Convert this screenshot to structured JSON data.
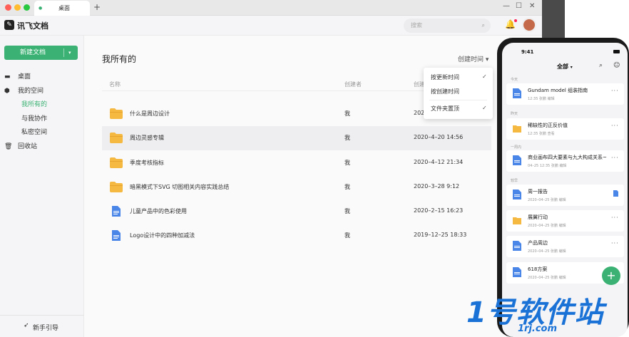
{
  "browser": {
    "tab_label": "桌面",
    "new_tab": "+",
    "min": "—",
    "max": "☐",
    "close": "✕"
  },
  "app": {
    "title": "讯飞文档",
    "logo_glyph": "✎",
    "search_placeholder": "搜索",
    "search_icon": "⌕",
    "bell_icon": "🔔"
  },
  "sidebar": {
    "new_button": "新建文档",
    "new_caret": "▾",
    "items": [
      {
        "label": "桌面",
        "icon": "▬"
      },
      {
        "label": "我的空间",
        "icon": "⬢"
      },
      {
        "label": "我所有的"
      },
      {
        "label": "与我协作"
      },
      {
        "label": "私密空间"
      },
      {
        "label": "回收站",
        "icon": "🗑"
      }
    ],
    "guide": "新手引导",
    "guide_icon": "➶"
  },
  "main": {
    "title": "我所有的",
    "sort_label": "创建时间 ▾",
    "headers": {
      "name": "名称",
      "creator": "创建者",
      "date": "创建"
    },
    "rows": [
      {
        "name": "什么是周边设计",
        "creator": "我",
        "date": "2020",
        "type": "folder"
      },
      {
        "name": "周边灵感专辑",
        "creator": "我",
        "date": "2020–4–20 14:56",
        "type": "folder"
      },
      {
        "name": "季度考核指标",
        "creator": "我",
        "date": "2020–4–12 21:34",
        "type": "folder"
      },
      {
        "name": "暗黑模式下SVG 切图相关内容实践总结",
        "creator": "我",
        "date": "2020–3–28 9:12",
        "type": "folder"
      },
      {
        "name": "儿童产品中的色彩使用",
        "creator": "我",
        "date": "2020–2–15 16:23",
        "type": "doc"
      },
      {
        "name": "Logo设计中的四种加减法",
        "creator": "我",
        "date": "2019–12–25  18:33",
        "type": "doc"
      }
    ],
    "menu": {
      "items": [
        "按更新时间",
        "按创建时间",
        "文件夹置顶"
      ],
      "check": "✓"
    }
  },
  "phone": {
    "time": "9:41",
    "filter": "全部",
    "filter_caret": "▾",
    "search_icon": "⌕",
    "chat_icon": "☺",
    "sections": [
      "今天",
      "昨天",
      "一周内",
      "较早"
    ],
    "cards": [
      {
        "title": "Gundam model 组装指南",
        "meta": "12:35  张鹏 编辑",
        "type": "doc",
        "more": "···"
      },
      {
        "title": "稀缺性的正反价值",
        "meta": "12:35  张鹏 查看",
        "type": "folder",
        "more": "···"
      },
      {
        "title": "商业画布四大要素与九大构成关系~",
        "meta": "04–25 12:35  张鹏 编辑",
        "type": "doc",
        "more": "···"
      },
      {
        "title": "周一报告",
        "meta": "2020–04–25  张鹏 编辑",
        "type": "doc"
      },
      {
        "title": "展翼行动",
        "meta": "2020–04–25  张鹏 编辑",
        "type": "folder",
        "more": "···"
      },
      {
        "title": "产品周边",
        "meta": "2020–04–25  张鹏 编辑",
        "type": "doc",
        "more": "···"
      },
      {
        "title": "618方案",
        "meta": "2020–04–25  张鹏 编辑",
        "type": "doc"
      }
    ],
    "fab": "+"
  },
  "watermark": {
    "big": "1号软件站",
    "small": "1rj.com"
  },
  "colors": {
    "accent": "#3bb273",
    "folder": "#f5b840",
    "doc": "#4a86e8",
    "watermark": "#1a72d6"
  }
}
